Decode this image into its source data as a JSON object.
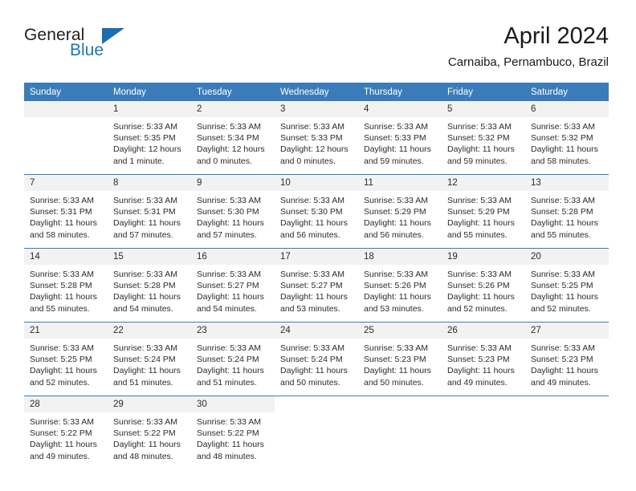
{
  "logo": {
    "general": "General",
    "blue": "Blue",
    "triangle": "blue-triangle"
  },
  "header": {
    "title": "April 2024",
    "subtitle": "Carnaiba, Pernambuco, Brazil"
  },
  "colors": {
    "header_blue": "#3a7cb9",
    "daynum_band": "#f2f2f2",
    "logo_blue": "#1b75bb",
    "text": "#2b2b2b"
  },
  "calendar": {
    "weekday_headers": [
      "Sunday",
      "Monday",
      "Tuesday",
      "Wednesday",
      "Thursday",
      "Friday",
      "Saturday"
    ],
    "weeks": [
      [
        {
          "day": "",
          "lines": []
        },
        {
          "day": "1",
          "lines": [
            "Sunrise: 5:33 AM",
            "Sunset: 5:35 PM",
            "Daylight: 12 hours",
            "and 1 minute."
          ]
        },
        {
          "day": "2",
          "lines": [
            "Sunrise: 5:33 AM",
            "Sunset: 5:34 PM",
            "Daylight: 12 hours",
            "and 0 minutes."
          ]
        },
        {
          "day": "3",
          "lines": [
            "Sunrise: 5:33 AM",
            "Sunset: 5:33 PM",
            "Daylight: 12 hours",
            "and 0 minutes."
          ]
        },
        {
          "day": "4",
          "lines": [
            "Sunrise: 5:33 AM",
            "Sunset: 5:33 PM",
            "Daylight: 11 hours",
            "and 59 minutes."
          ]
        },
        {
          "day": "5",
          "lines": [
            "Sunrise: 5:33 AM",
            "Sunset: 5:32 PM",
            "Daylight: 11 hours",
            "and 59 minutes."
          ]
        },
        {
          "day": "6",
          "lines": [
            "Sunrise: 5:33 AM",
            "Sunset: 5:32 PM",
            "Daylight: 11 hours",
            "and 58 minutes."
          ]
        }
      ],
      [
        {
          "day": "7",
          "lines": [
            "Sunrise: 5:33 AM",
            "Sunset: 5:31 PM",
            "Daylight: 11 hours",
            "and 58 minutes."
          ]
        },
        {
          "day": "8",
          "lines": [
            "Sunrise: 5:33 AM",
            "Sunset: 5:31 PM",
            "Daylight: 11 hours",
            "and 57 minutes."
          ]
        },
        {
          "day": "9",
          "lines": [
            "Sunrise: 5:33 AM",
            "Sunset: 5:30 PM",
            "Daylight: 11 hours",
            "and 57 minutes."
          ]
        },
        {
          "day": "10",
          "lines": [
            "Sunrise: 5:33 AM",
            "Sunset: 5:30 PM",
            "Daylight: 11 hours",
            "and 56 minutes."
          ]
        },
        {
          "day": "11",
          "lines": [
            "Sunrise: 5:33 AM",
            "Sunset: 5:29 PM",
            "Daylight: 11 hours",
            "and 56 minutes."
          ]
        },
        {
          "day": "12",
          "lines": [
            "Sunrise: 5:33 AM",
            "Sunset: 5:29 PM",
            "Daylight: 11 hours",
            "and 55 minutes."
          ]
        },
        {
          "day": "13",
          "lines": [
            "Sunrise: 5:33 AM",
            "Sunset: 5:28 PM",
            "Daylight: 11 hours",
            "and 55 minutes."
          ]
        }
      ],
      [
        {
          "day": "14",
          "lines": [
            "Sunrise: 5:33 AM",
            "Sunset: 5:28 PM",
            "Daylight: 11 hours",
            "and 55 minutes."
          ]
        },
        {
          "day": "15",
          "lines": [
            "Sunrise: 5:33 AM",
            "Sunset: 5:28 PM",
            "Daylight: 11 hours",
            "and 54 minutes."
          ]
        },
        {
          "day": "16",
          "lines": [
            "Sunrise: 5:33 AM",
            "Sunset: 5:27 PM",
            "Daylight: 11 hours",
            "and 54 minutes."
          ]
        },
        {
          "day": "17",
          "lines": [
            "Sunrise: 5:33 AM",
            "Sunset: 5:27 PM",
            "Daylight: 11 hours",
            "and 53 minutes."
          ]
        },
        {
          "day": "18",
          "lines": [
            "Sunrise: 5:33 AM",
            "Sunset: 5:26 PM",
            "Daylight: 11 hours",
            "and 53 minutes."
          ]
        },
        {
          "day": "19",
          "lines": [
            "Sunrise: 5:33 AM",
            "Sunset: 5:26 PM",
            "Daylight: 11 hours",
            "and 52 minutes."
          ]
        },
        {
          "day": "20",
          "lines": [
            "Sunrise: 5:33 AM",
            "Sunset: 5:25 PM",
            "Daylight: 11 hours",
            "and 52 minutes."
          ]
        }
      ],
      [
        {
          "day": "21",
          "lines": [
            "Sunrise: 5:33 AM",
            "Sunset: 5:25 PM",
            "Daylight: 11 hours",
            "and 52 minutes."
          ]
        },
        {
          "day": "22",
          "lines": [
            "Sunrise: 5:33 AM",
            "Sunset: 5:24 PM",
            "Daylight: 11 hours",
            "and 51 minutes."
          ]
        },
        {
          "day": "23",
          "lines": [
            "Sunrise: 5:33 AM",
            "Sunset: 5:24 PM",
            "Daylight: 11 hours",
            "and 51 minutes."
          ]
        },
        {
          "day": "24",
          "lines": [
            "Sunrise: 5:33 AM",
            "Sunset: 5:24 PM",
            "Daylight: 11 hours",
            "and 50 minutes."
          ]
        },
        {
          "day": "25",
          "lines": [
            "Sunrise: 5:33 AM",
            "Sunset: 5:23 PM",
            "Daylight: 11 hours",
            "and 50 minutes."
          ]
        },
        {
          "day": "26",
          "lines": [
            "Sunrise: 5:33 AM",
            "Sunset: 5:23 PM",
            "Daylight: 11 hours",
            "and 49 minutes."
          ]
        },
        {
          "day": "27",
          "lines": [
            "Sunrise: 5:33 AM",
            "Sunset: 5:23 PM",
            "Daylight: 11 hours",
            "and 49 minutes."
          ]
        }
      ],
      [
        {
          "day": "28",
          "lines": [
            "Sunrise: 5:33 AM",
            "Sunset: 5:22 PM",
            "Daylight: 11 hours",
            "and 49 minutes."
          ]
        },
        {
          "day": "29",
          "lines": [
            "Sunrise: 5:33 AM",
            "Sunset: 5:22 PM",
            "Daylight: 11 hours",
            "and 48 minutes."
          ]
        },
        {
          "day": "30",
          "lines": [
            "Sunrise: 5:33 AM",
            "Sunset: 5:22 PM",
            "Daylight: 11 hours",
            "and 48 minutes."
          ]
        },
        {
          "day": "",
          "lines": []
        },
        {
          "day": "",
          "lines": []
        },
        {
          "day": "",
          "lines": []
        },
        {
          "day": "",
          "lines": []
        }
      ]
    ]
  }
}
